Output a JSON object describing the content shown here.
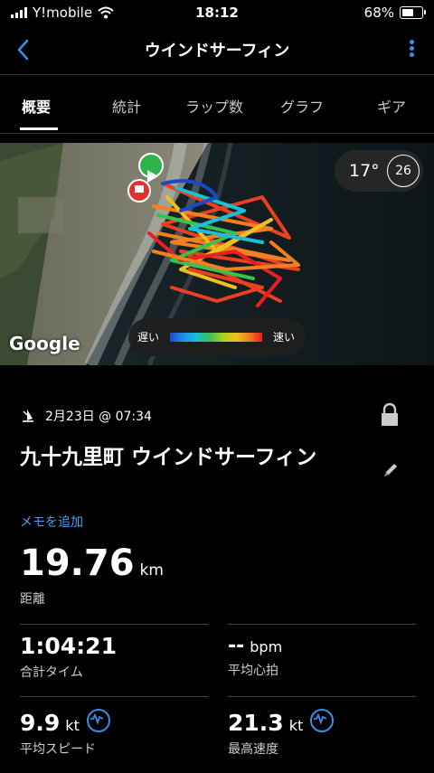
{
  "status_bar": {
    "carrier": "Y!mobile",
    "time": "18:12",
    "battery_percent": "68%",
    "battery_level": 0.68
  },
  "nav": {
    "title": "ウインドサーフィン",
    "back_icon": "chevron-left-icon",
    "more_icon": "more-vertical-icon",
    "accent_color": "#3b8be8"
  },
  "tabs": [
    {
      "label": "概要",
      "active": true
    },
    {
      "label": "統計",
      "active": false
    },
    {
      "label": "ラップ数",
      "active": false
    },
    {
      "label": "グラフ",
      "active": false
    },
    {
      "label": "ギア",
      "active": false
    }
  ],
  "map": {
    "temperature": "17°",
    "wind_speed": "26",
    "legend_slow": "遅い",
    "legend_fast": "速い",
    "provider": "Google"
  },
  "activity": {
    "date": "2月23日 @ 07:34",
    "title": "九十九里町 ウインドサーフィン",
    "memo_link": "メモを追加",
    "distance_value": "19.76",
    "distance_unit": "km",
    "distance_label": "距離"
  },
  "stats": [
    {
      "value": "1:04:21",
      "unit": "",
      "label": "合計タイム"
    },
    {
      "value": "--",
      "unit": "bpm",
      "label": "平均心拍"
    },
    {
      "value": "9.9",
      "unit": "kt",
      "label": "平均スピード"
    },
    {
      "value": "21.3",
      "unit": "kt",
      "label": "最高速度"
    }
  ]
}
